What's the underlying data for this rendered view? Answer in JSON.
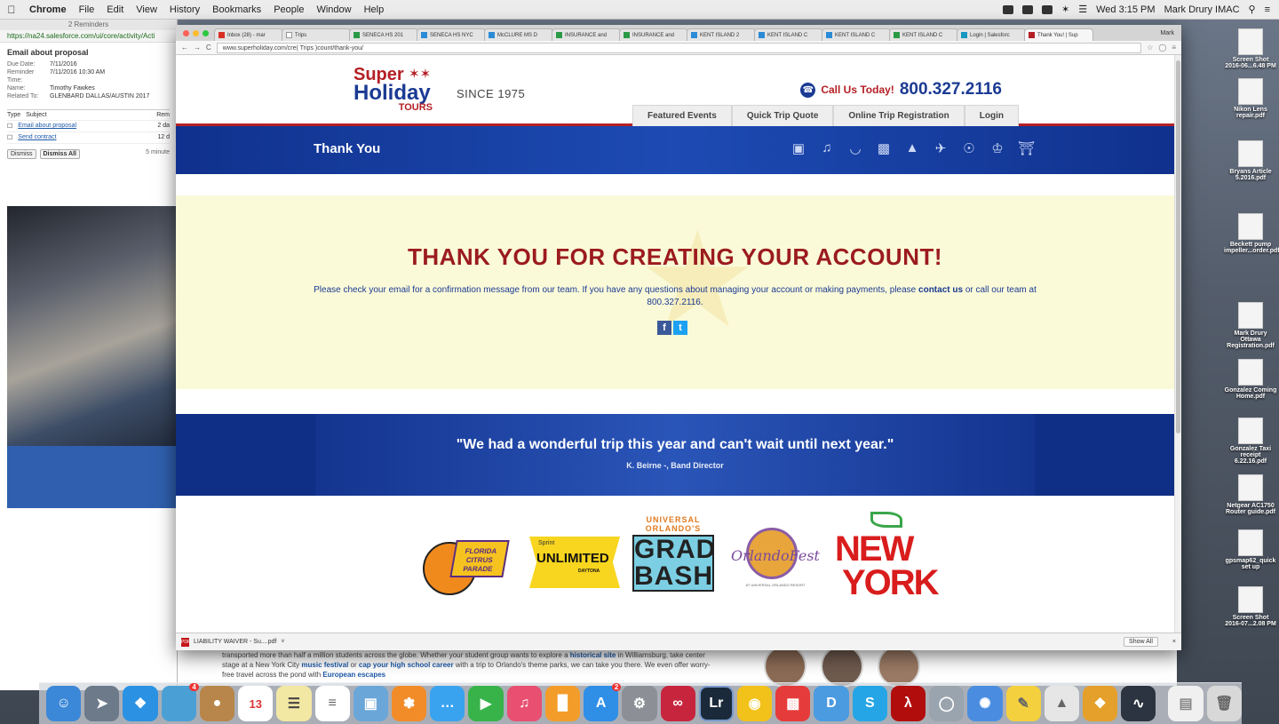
{
  "menubar": {
    "app": "Chrome",
    "menus": [
      "File",
      "Edit",
      "View",
      "History",
      "Bookmarks",
      "People",
      "Window",
      "Help"
    ],
    "clock": "Wed 3:15 PM",
    "user": "Mark Drury IMAC"
  },
  "salesforce": {
    "title": "2 Reminders",
    "url": "https://na24.salesforce.com/ui/core/activity/Acti",
    "heading": "Email about proposal",
    "fields": [
      {
        "k": "Due Date:",
        "v": "7/11/2016"
      },
      {
        "k": "Reminder Time:",
        "v": "7/11/2016 10:30 AM"
      },
      {
        "k": "Name:",
        "v": "Timothy Fawkes"
      },
      {
        "k": "Related To:",
        "v": "GLENBARD DALLAS/AUSTIN 2017"
      }
    ],
    "table_header": [
      "Type",
      "Subject",
      "Rem"
    ],
    "rows": [
      {
        "subject": "Email about proposal",
        "rem": "2 da"
      },
      {
        "subject": "Send contract",
        "rem": "12 d"
      }
    ],
    "dismiss": "Dismiss",
    "dismiss_all": "Dismiss All",
    "snooze": "5 minute"
  },
  "chrome": {
    "tabs": [
      "Inbox (28) - mar",
      "Trips",
      "SENECA HS 201",
      "SENECA HS NYC",
      "McCLURE MS D",
      "INSURANCE and",
      "INSURANCE and",
      "KENT ISLAND 2",
      "KENT ISLAND C",
      "KENT ISLAND C",
      "KENT ISLAND C",
      "Login | Salesforc",
      "Thank You! | Sup"
    ],
    "profile": "Mark",
    "url": "www.superholiday.com/cre( Trips )count/thank-you/",
    "download_file": "LIABILITY WAIVER - Su....pdf",
    "show_all": "Show All"
  },
  "site": {
    "logo": {
      "line1": "Super",
      "line2": "Holiday",
      "line3": "TOURS"
    },
    "since": "SINCE 1975",
    "call_label": "Call Us Today!",
    "phone": "800.327.2116",
    "nav": [
      "Featured Events",
      "Quick Trip Quote",
      "Online Trip Registration",
      "Login"
    ],
    "banner_title": "Thank You",
    "banner_icons": [
      "map-icon",
      "music-icon",
      "basket-icon",
      "luggage-icon",
      "graduation-cap-icon",
      "plane-icon",
      "globe-icon",
      "dancer-icon",
      "museum-icon"
    ],
    "thank_title": "THANK YOU FOR CREATING YOUR ACCOUNT!",
    "thank_msg_a": "Please check your email for a confirmation message from our team. If you have any questions about managing your account or making payments, please",
    "thank_msg_link": "contact us",
    "thank_msg_b": "or call our team at 800.327.2116.",
    "quote": "\"We had a wonderful trip this year and can't wait until next year.\"",
    "quote_by": "K. Beirne -, Band Director",
    "partners": {
      "citrus": "FLORIDA CITRUS PARADE",
      "sprint_top": "Sprint",
      "sprint_main": "UNLIMITED",
      "sprint_sub": "DAYTONA",
      "grad_top": "UNIVERSAL ORLANDO'S",
      "grad_main": "GRAD BASH",
      "ofest": "OrlandoFest",
      "ofest_sub": "AT UNIVERSAL ORLANDO RESORT",
      "ny_1": "NEW",
      "ny_2": "YORK"
    },
    "behind_text_a": "transported more than half a million students across the globe. Whether your student group wants to explore a",
    "behind_link1": "historical site",
    "behind_text_b": "in Williamsburg, take center stage at a New York City",
    "behind_link2": "music festival",
    "behind_text_c": "or",
    "behind_link3": "cap your high school career",
    "behind_text_d": "with a trip to Orlando's theme parks, we can take you there. We even offer worry-free travel across the pond with",
    "behind_link4": "European escapes"
  },
  "desktop_icons": [
    {
      "label": "Screen Shot 2016-06...6.48 PM"
    },
    {
      "label": "Nikon Lens repair.pdf"
    },
    {
      "label": "Bryans Article 5.2016.pdf"
    },
    {
      "label": "Beckett pump impeller...order.pdf"
    },
    {
      "label": "Mark Drury Ottawa Registration.pdf"
    },
    {
      "label": "Gonzalez Coming Home.pdf"
    },
    {
      "label": "Gonzalez Taxi receipt 6.22.16.pdf"
    },
    {
      "label": "Netgear AC1750 Router guide.pdf"
    },
    {
      "label": "gpsmap62_quick set up"
    },
    {
      "label": "Screen Shot 2016-07...2.08 PM"
    }
  ],
  "dock": {
    "badges": {
      "photos": "4",
      "appstore": "2"
    },
    "calendar_day": "13"
  }
}
